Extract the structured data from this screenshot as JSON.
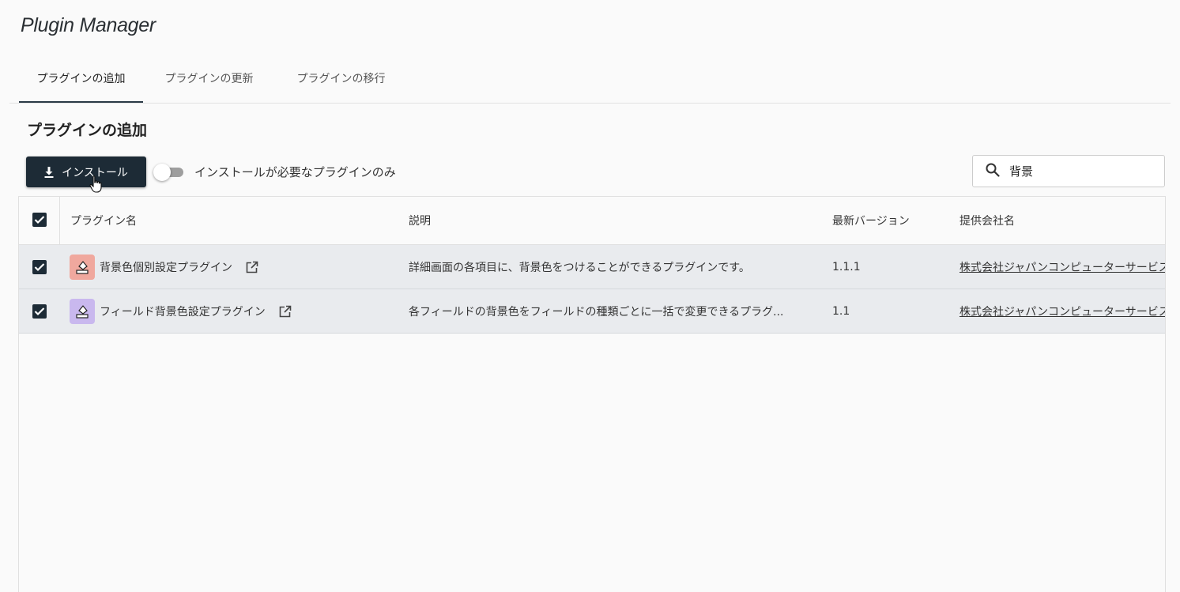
{
  "app": {
    "title": "Plugin Manager"
  },
  "tabs": [
    {
      "label": "プラグインの追加",
      "active": true
    },
    {
      "label": "プラグインの更新",
      "active": false
    },
    {
      "label": "プラグインの移行",
      "active": false
    }
  ],
  "section_title": "プラグインの追加",
  "toolbar": {
    "install_label": "インストール",
    "toggle_label": "インストールが必要なプラグインのみ",
    "toggle_on": false
  },
  "search": {
    "value": "背景",
    "placeholder": ""
  },
  "table": {
    "columns": [
      "プラグイン名",
      "説明",
      "最新バージョン",
      "提供会社名"
    ],
    "select_all_checked": true,
    "rows": [
      {
        "checked": true,
        "icon": "paint-bucket-icon",
        "icon_color": "#f0a89e",
        "name": "背景色個別設定プラグイン",
        "description": "詳細画面の各項目に、背景色をつけることができるプラグインです。",
        "version": "1.1.1",
        "vendor": "株式会社ジャパンコンピューターサービス"
      },
      {
        "checked": true,
        "icon": "paint-bucket-icon",
        "icon_color": "#c9b8ee",
        "name": "フィールド背景色設定プラグイン",
        "description": "各フィールドの背景色をフィールドの種類ごとに一括で変更できるプラグ...",
        "version": "1.1",
        "vendor": "株式会社ジャパンコンピューターサービス"
      }
    ]
  },
  "colors": {
    "primary": "#1d2b36",
    "row_selected": "#e9ebee"
  }
}
